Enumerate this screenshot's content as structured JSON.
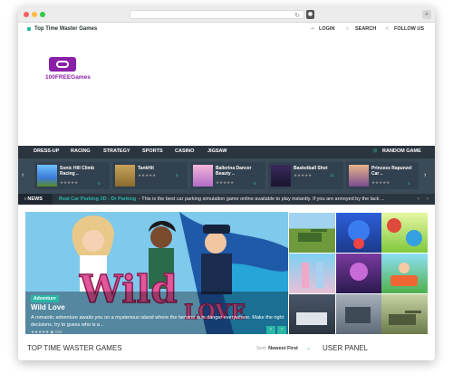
{
  "topbar": {
    "site_name": "Top Time Waster Games",
    "login": "LOGIN",
    "search": "SEARCH",
    "follow": "FOLLOW US"
  },
  "logo": {
    "text": "100FREEGames"
  },
  "nav": {
    "items": [
      "DRESS-UP",
      "RACING",
      "STRATEGY",
      "SPORTS",
      "CASINO",
      "JIGSAW"
    ],
    "random": "RANDOM GAME"
  },
  "carousel": {
    "cards": [
      {
        "title1": "Sonic Hill Climb",
        "title2": "Racing ..",
        "count": "5"
      },
      {
        "title1": "TankHit",
        "title2": "",
        "count": "5"
      },
      {
        "title1": "Ballerina Dancer",
        "title2": "Beauty ..",
        "count": "6"
      },
      {
        "title1": "Basketball Shot",
        "title2": "",
        "count": "11"
      },
      {
        "title1": "Princess Rapunzel",
        "title2": "Car ..",
        "count": "4"
      }
    ]
  },
  "news": {
    "label": "NEWS",
    "link": "Real Car Parking 3D : Dr Parking",
    "text": " - This is the best car parking simulation game online available to play instantly. If you are annoyed by the lack ..."
  },
  "hero": {
    "tag": "Adventure",
    "title": "Wild Love",
    "desc": "A romantic adventure awaits you on a mysterious island where the heroine is in danger everywhere. Make the right decisions, try to guess who is a ..",
    "count": "104",
    "art_title": "Wild",
    "art_sub": "LOVE"
  },
  "section": {
    "title": "TOP TIME WASTER GAMES",
    "sort_label": "Sort:",
    "sort_value": "Newest First",
    "user_panel": "USER PANEL"
  },
  "colors": {
    "accent": "#29b6a5",
    "nav": "#2b3540",
    "carousel": "#3a4a57",
    "brand": "#8b1fa8"
  }
}
